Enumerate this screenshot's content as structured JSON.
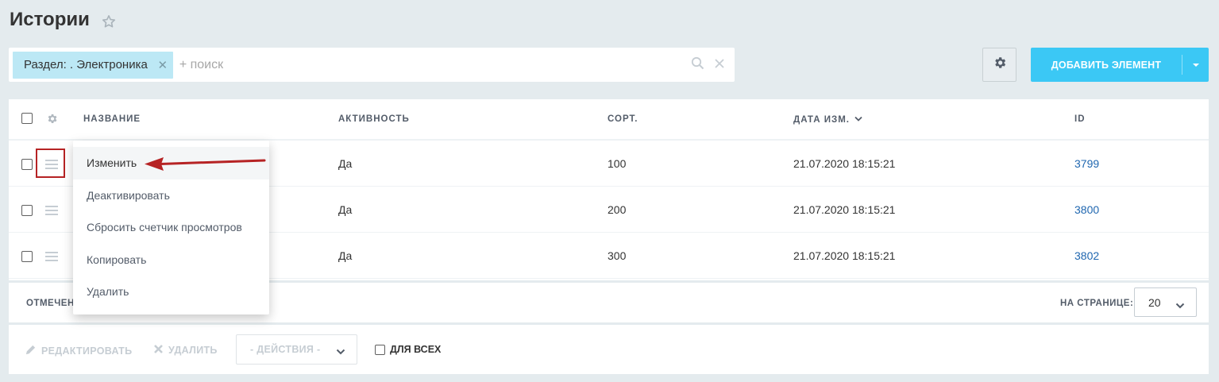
{
  "page": {
    "title": "Истории"
  },
  "filter": {
    "chip_label": "Раздел: . Электроника",
    "search_placeholder": "+ поиск"
  },
  "toolbar": {
    "add_label": "ДОБАВИТЬ ЭЛЕМЕНТ"
  },
  "grid": {
    "columns": [
      {
        "label": "НАЗВАНИЕ"
      },
      {
        "label": "АКТИВНОСТЬ"
      },
      {
        "label": "СОРТ."
      },
      {
        "label": "ДАТА ИЗМ.",
        "sorted": "desc"
      },
      {
        "label": "ID"
      }
    ],
    "rows": [
      {
        "name": "",
        "active": "Да",
        "sort": "100",
        "date": "21.07.2020 18:15:21",
        "id": "3799"
      },
      {
        "name": "",
        "active": "Да",
        "sort": "200",
        "date": "21.07.2020 18:15:21",
        "id": "3800"
      },
      {
        "name": "",
        "active": "Да",
        "sort": "300",
        "date": "21.07.2020 18:15:21",
        "id": "3802"
      }
    ]
  },
  "context_menu": {
    "items": [
      {
        "label": "Изменить",
        "highlighted": true
      },
      {
        "label": "Деактивировать"
      },
      {
        "label": "Сбросить счетчик просмотров"
      },
      {
        "label": "Копировать"
      },
      {
        "label": "Удалить"
      }
    ]
  },
  "footer": {
    "selected_label": "ОТМЕЧЕН",
    "per_page_label": "НА СТРАНИЦЕ:",
    "per_page_value": "20"
  },
  "actions": {
    "edit_label": "РЕДАКТИРОВАТЬ",
    "delete_label": "УДАЛИТЬ",
    "actions_select": "- ДЕЙСТВИЯ -",
    "for_all_label": "ДЛЯ ВСЕХ"
  },
  "colors": {
    "accent": "#3bc8f5",
    "chip": "#bce8f5",
    "link": "#2067b0",
    "annotation": "#b62324"
  },
  "icons": {
    "star": "star-icon",
    "settings": "gear-icon",
    "search": "search-icon",
    "clear": "close-icon",
    "row_menu": "burger-icon",
    "edit": "pencil-icon",
    "delete": "cross-icon"
  }
}
